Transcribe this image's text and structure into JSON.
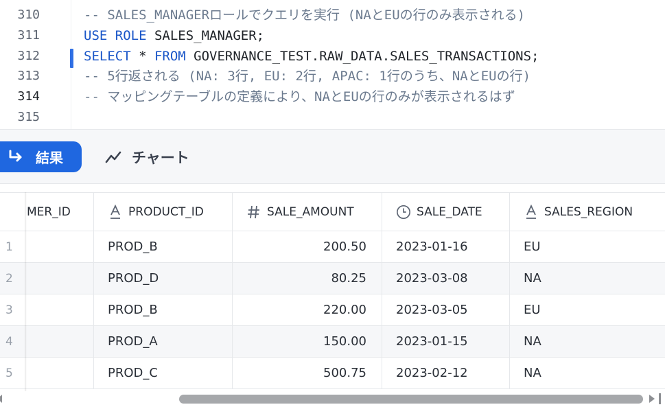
{
  "editor": {
    "lines": [
      {
        "num": "310",
        "parts": [
          {
            "t": "-- SALES_MANAGERロールでクエリを実行 (NAとEUの行のみ表示される)",
            "c": "comment"
          }
        ]
      },
      {
        "num": "311",
        "parts": [
          {
            "t": "USE ROLE",
            "c": "keyword"
          },
          {
            "t": " SALES_MANAGER;",
            "c": "plain"
          }
        ]
      },
      {
        "num": "312",
        "parts": [
          {
            "t": "SELECT",
            "c": "keyword"
          },
          {
            "t": " * ",
            "c": "plain"
          },
          {
            "t": "FROM",
            "c": "keyword"
          },
          {
            "t": " GOVERNANCE_TEST.RAW_DATA.SALES_TRANSACTIONS;",
            "c": "plain"
          }
        ]
      },
      {
        "num": "313",
        "parts": [
          {
            "t": "-- 5行返される (NA: 3行, EU: 2行, APAC: 1行のうち、NAとEUの行)",
            "c": "comment"
          }
        ]
      },
      {
        "num": "314",
        "parts": [
          {
            "t": "-- マッピングテーブルの定義により、NAとEUの行のみが表示されるはず",
            "c": "comment"
          }
        ]
      },
      {
        "num": "315",
        "parts": []
      }
    ],
    "active_line": "314",
    "colors": {
      "keyword": "#1a56c8",
      "comment": "#6b7a8e",
      "accent": "#2f6fe4"
    }
  },
  "tabs": {
    "results_label": "結果",
    "results_icon": "return-arrow-icon",
    "chart_label": "チャート",
    "chart_icon": "line-chart-icon"
  },
  "table": {
    "columns": [
      {
        "label": "MER_ID",
        "icon": ""
      },
      {
        "label": "PRODUCT_ID",
        "icon": "text-type-icon"
      },
      {
        "label": "SALE_AMOUNT",
        "icon": "number-type-icon"
      },
      {
        "label": "SALE_DATE",
        "icon": "clock-type-icon"
      },
      {
        "label": "SALES_REGION",
        "icon": "text-type-icon"
      }
    ],
    "rows": [
      {
        "n": "1",
        "cust": "",
        "product": "PROD_B",
        "amount": "200.50",
        "date": "2023-01-16",
        "region": "EU"
      },
      {
        "n": "2",
        "cust": "",
        "product": "PROD_D",
        "amount": "80.25",
        "date": "2023-03-08",
        "region": "NA"
      },
      {
        "n": "3",
        "cust": "",
        "product": "PROD_B",
        "amount": "220.00",
        "date": "2023-03-05",
        "region": "EU"
      },
      {
        "n": "4",
        "cust": "",
        "product": "PROD_A",
        "amount": "150.00",
        "date": "2023-01-15",
        "region": "NA"
      },
      {
        "n": "5",
        "cust": "",
        "product": "PROD_C",
        "amount": "500.75",
        "date": "2023-02-12",
        "region": "NA"
      }
    ]
  }
}
